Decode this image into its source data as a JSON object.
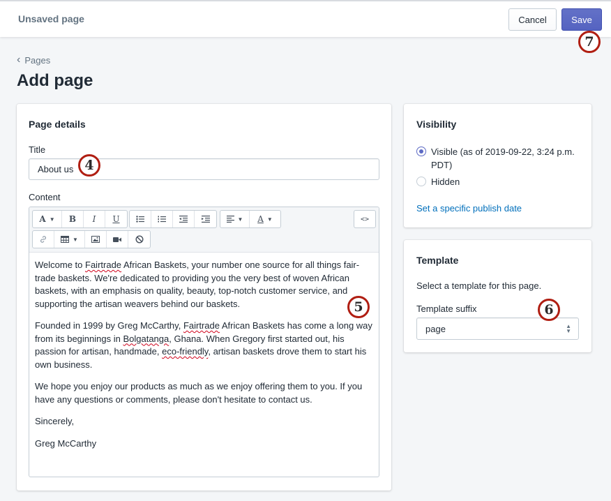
{
  "topbar": {
    "title": "Unsaved page",
    "cancel_label": "Cancel",
    "save_label": "Save"
  },
  "breadcrumb": {
    "label": "Pages"
  },
  "page_title": "Add page",
  "annotations": [
    "4",
    "5",
    "6",
    "7"
  ],
  "page_details": {
    "heading": "Page details",
    "title_label": "Title",
    "title_value": "About us",
    "content_label": "Content",
    "toolbar": {
      "format": "A",
      "bold": "B",
      "italic": "I",
      "underline": "U",
      "color": "A",
      "html": "<>"
    },
    "content": {
      "p1": [
        "Welcome to ",
        "Fairtrade",
        " African Baskets, your number one source for all things fair-trade baskets. We're dedicated to providing you the very best of woven African baskets, with an emphasis on quality, beauty, top-notch customer service, and supporting the artisan weavers behind our baskets."
      ],
      "p2": [
        "Founded in 1999 by Greg McCarthy, ",
        "Fairtrade",
        " African Baskets has come a long way from its beginnings in ",
        "Bolgatanga",
        ", Ghana. When Gregory first started out, his passion for artisan, handmade, ",
        "eco-friendly",
        ", artisan baskets drove them to start his own business."
      ],
      "p3": "We hope you enjoy our products as much as we enjoy offering them to you. If you have any questions or comments, please don't hesitate to contact us.",
      "p4": "Sincerely,",
      "p5": "Greg McCarthy"
    }
  },
  "visibility": {
    "heading": "Visibility",
    "visible_label": "Visible (as of 2019-09-22, 3:24 p.m. PDT)",
    "hidden_label": "Hidden",
    "selected": "visible",
    "publish_link": "Set a specific publish date"
  },
  "template": {
    "heading": "Template",
    "description": "Select a template for this page.",
    "suffix_label": "Template suffix",
    "suffix_value": "page"
  },
  "colors": {
    "accent": "#5c6ac4",
    "link": "#006fbb",
    "annotation": "#b01e12"
  }
}
